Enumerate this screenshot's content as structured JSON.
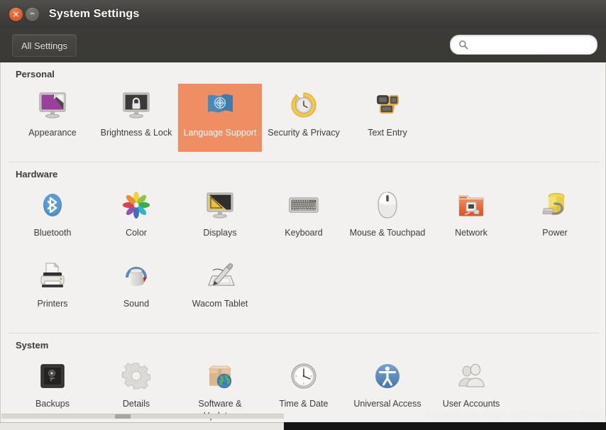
{
  "window": {
    "title": "System Settings",
    "close_glyph": "×",
    "minimize_glyph": "–"
  },
  "toolbar": {
    "all_settings_label": "All Settings",
    "search_placeholder": "",
    "search_value": "",
    "search_icon": "search-icon"
  },
  "colors": {
    "selection": "#ef8e62",
    "titlebar": "#403f3c",
    "content_bg": "#f2f1f0",
    "close_button": "#df5b2c"
  },
  "sections": [
    {
      "title": "Personal",
      "items": [
        {
          "label": "Appearance",
          "icon": "appearance-icon",
          "selected": false
        },
        {
          "label": "Brightness & Lock",
          "icon": "brightness-lock-icon",
          "selected": false
        },
        {
          "label": "Language Support",
          "icon": "language-support-icon",
          "selected": true
        },
        {
          "label": "Security & Privacy",
          "icon": "security-privacy-icon",
          "selected": false
        },
        {
          "label": "Text Entry",
          "icon": "text-entry-icon",
          "selected": false
        }
      ]
    },
    {
      "title": "Hardware",
      "items": [
        {
          "label": "Bluetooth",
          "icon": "bluetooth-icon",
          "selected": false
        },
        {
          "label": "Color",
          "icon": "color-icon",
          "selected": false
        },
        {
          "label": "Displays",
          "icon": "displays-icon",
          "selected": false
        },
        {
          "label": "Keyboard",
          "icon": "keyboard-icon",
          "selected": false
        },
        {
          "label": "Mouse & Touchpad",
          "icon": "mouse-touchpad-icon",
          "selected": false
        },
        {
          "label": "Network",
          "icon": "network-icon",
          "selected": false
        },
        {
          "label": "Power",
          "icon": "power-icon",
          "selected": false
        },
        {
          "label": "Printers",
          "icon": "printers-icon",
          "selected": false
        },
        {
          "label": "Sound",
          "icon": "sound-icon",
          "selected": false
        },
        {
          "label": "Wacom Tablet",
          "icon": "wacom-tablet-icon",
          "selected": false
        }
      ]
    },
    {
      "title": "System",
      "items": [
        {
          "label": "Backups",
          "icon": "backups-icon",
          "selected": false
        },
        {
          "label": "Details",
          "icon": "details-icon",
          "selected": false
        },
        {
          "label": "Software & Updates",
          "icon": "software-updates-icon",
          "selected": false
        },
        {
          "label": "Time & Date",
          "icon": "time-date-icon",
          "selected": false
        },
        {
          "label": "Universal Access",
          "icon": "universal-access-icon",
          "selected": false
        },
        {
          "label": "User Accounts",
          "icon": "user-accounts-icon",
          "selected": false
        }
      ]
    }
  ],
  "watermark": "https://blog.csdn.net/Ricardo232525"
}
